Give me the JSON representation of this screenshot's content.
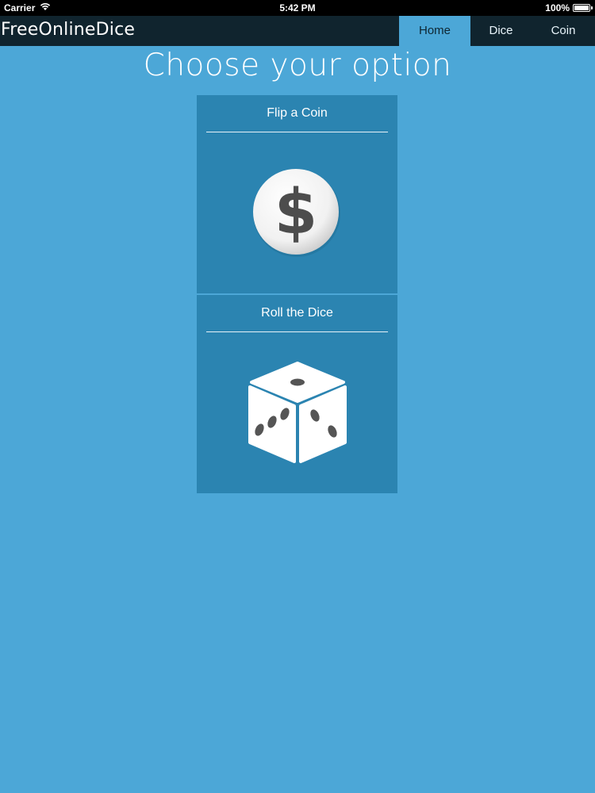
{
  "status_bar": {
    "carrier": "Carrier",
    "time": "5:42 PM",
    "battery": "100%",
    "battery_level": 1.0
  },
  "navbar": {
    "brand": "FreeOnlineDice",
    "items": [
      {
        "label": "Home",
        "active": true
      },
      {
        "label": "Dice",
        "active": false
      },
      {
        "label": "Coin",
        "active": false
      }
    ]
  },
  "page": {
    "heading": "Choose your option"
  },
  "options": [
    {
      "title": "Flip a Coin",
      "icon": "dollar-coin-icon"
    },
    {
      "title": "Roll the Dice",
      "icon": "dice-icon"
    }
  ],
  "colors": {
    "background": "#4ca7d7",
    "navbar": "#10242e",
    "card": "#2b84b1",
    "active_tab": "#4ca7d7"
  }
}
